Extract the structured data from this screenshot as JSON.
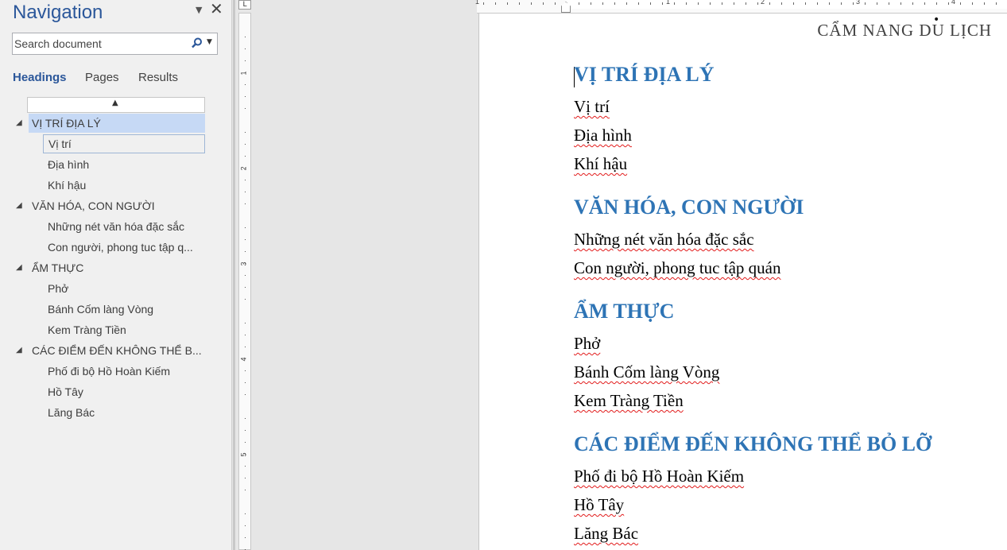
{
  "navigation": {
    "title": "Navigation",
    "search_placeholder": "Search document",
    "tabs": [
      "Headings",
      "Pages",
      "Results"
    ],
    "active_tab": "Headings",
    "tree": [
      {
        "label": "VỊ TRÍ ĐỊA LÝ",
        "level": 1,
        "selected": true
      },
      {
        "label": "Vị trí",
        "level": 2,
        "current": true
      },
      {
        "label": "Địa hình",
        "level": 2
      },
      {
        "label": "Khí hậu",
        "level": 2
      },
      {
        "label": "VĂN HÓA, CON NGƯỜI",
        "level": 1
      },
      {
        "label": "Những nét văn hóa đặc sắc",
        "level": 2
      },
      {
        "label": "Con người, phong tuc tập q...",
        "level": 2
      },
      {
        "label": "ẨM THỰC",
        "level": 1
      },
      {
        "label": "Phở",
        "level": 2
      },
      {
        "label": "Bánh Cốm làng Vòng",
        "level": 2
      },
      {
        "label": "Kem Tràng Tiền",
        "level": 2
      },
      {
        "label": "CÁC ĐIỂM ĐẾN KHÔNG THỂ B...",
        "level": 1
      },
      {
        "label": "Phố đi bộ Hồ Hoàn Kiếm",
        "level": 2
      },
      {
        "label": "Hồ Tây",
        "level": 2
      },
      {
        "label": "Lăng Bác",
        "level": 2
      }
    ]
  },
  "rulers": {
    "corner_label": "L",
    "horizontal_numbers": [
      "1",
      "1",
      "2",
      "3",
      "4"
    ],
    "vertical_numbers": [
      "1",
      "2",
      "3",
      "4",
      "5"
    ]
  },
  "document": {
    "header": "CẨM NANG DU LỊCH",
    "blocks": [
      {
        "type": "heading",
        "text": "VỊ TRÍ ĐỊA LÝ"
      },
      {
        "type": "para",
        "text": "Vị trí"
      },
      {
        "type": "para",
        "text": "Địa hình"
      },
      {
        "type": "para",
        "text": "Khí hậu"
      },
      {
        "type": "heading",
        "text": "VĂN HÓA, CON NGƯỜI"
      },
      {
        "type": "para",
        "text": "Những nét văn hóa đặc sắc"
      },
      {
        "type": "para",
        "text": "Con người, phong tuc tập quán"
      },
      {
        "type": "heading",
        "text": "ẨM THỰC"
      },
      {
        "type": "para",
        "text": "Phở"
      },
      {
        "type": "para",
        "text": "Bánh Cốm làng Vòng"
      },
      {
        "type": "para",
        "text": "Kem Tràng Tiền"
      },
      {
        "type": "heading",
        "text": "CÁC ĐIỂM ĐẾN KHÔNG THỂ BỎ LỠ"
      },
      {
        "type": "para",
        "text": "Phố đi bộ Hồ Hoàn Kiếm"
      },
      {
        "type": "para",
        "text": "Hồ Tây"
      },
      {
        "type": "para",
        "text": "Lăng Bác"
      }
    ]
  },
  "colors": {
    "accent": "#2b579a",
    "heading": "#2e74b5",
    "selection": "#c6d9f5",
    "spellcheck": "#e21b1b"
  }
}
